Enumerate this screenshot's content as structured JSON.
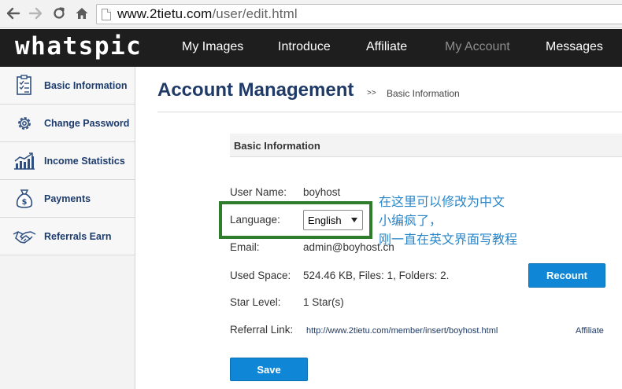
{
  "browser": {
    "url_host": "www.2tietu.com",
    "url_path": "/user/edit.html"
  },
  "header": {
    "logo": "whatspic",
    "nav": [
      {
        "label": "My Images",
        "active": false
      },
      {
        "label": "Introduce",
        "active": false
      },
      {
        "label": "Affiliate",
        "active": false
      },
      {
        "label": "My Account",
        "active": true
      },
      {
        "label": "Messages",
        "active": false
      }
    ]
  },
  "sidebar": {
    "items": [
      {
        "label": "Basic Information",
        "icon": "form-icon"
      },
      {
        "label": "Change Password",
        "icon": "gear-icon"
      },
      {
        "label": "Income Statistics",
        "icon": "chart-icon"
      },
      {
        "label": "Payments",
        "icon": "money-bag-icon"
      },
      {
        "label": "Referrals Earn",
        "icon": "handshake-icon"
      }
    ]
  },
  "main": {
    "title": "Account Management",
    "breadcrumb_sep": ">>",
    "breadcrumb": "Basic Information",
    "section_title": "Basic Information",
    "fields": {
      "username": {
        "label": "User Name:",
        "value": "boyhost"
      },
      "language": {
        "label": "Language:",
        "value": "English"
      },
      "email": {
        "label": "Email:",
        "value": "admin@boyhost.cn"
      },
      "space": {
        "label": "Used Space:",
        "value": "524.46 KB, Files: 1, Folders: 2."
      },
      "star": {
        "label": "Star Level:",
        "value": "1  Star(s)"
      },
      "referral": {
        "label": "Referral Link:",
        "value": "http://www.2tietu.com/member/insert/boyhost.html"
      }
    },
    "recount_label": "Recount",
    "affiliate_link": "Affiliate",
    "save_label": "Save"
  },
  "annotation": {
    "lines": [
      "在这里可以修改为中文",
      "小编疯了，",
      "刚一直在英文界面写教程"
    ],
    "color": "#2a86c8"
  },
  "colors": {
    "accent": "#0f87d6",
    "title": "#1f3a66",
    "highlight": "#2e7d2c"
  }
}
